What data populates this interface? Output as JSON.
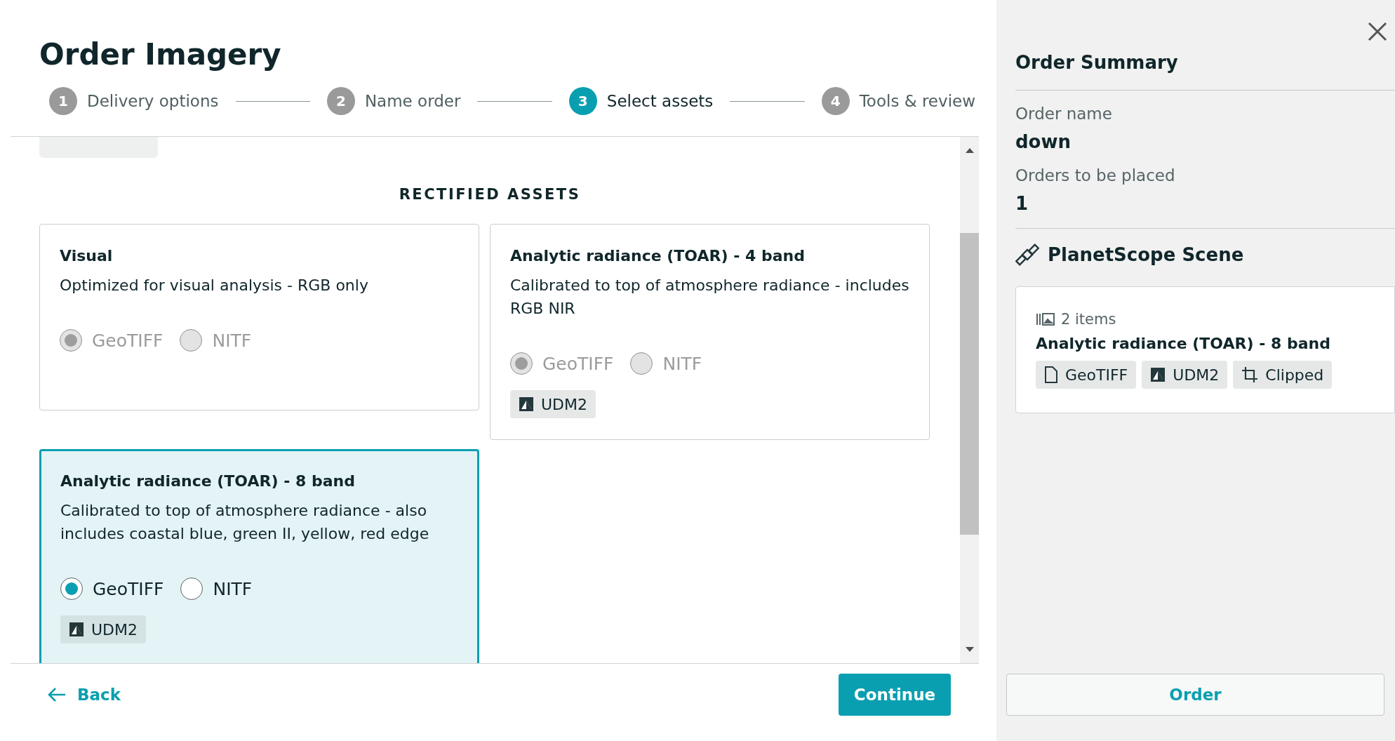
{
  "title": "Order Imagery",
  "steps": [
    {
      "number": "1",
      "label": "Delivery options",
      "selected": false
    },
    {
      "number": "2",
      "label": "Name order",
      "selected": false
    },
    {
      "number": "3",
      "label": "Select assets",
      "selected": true
    },
    {
      "number": "4",
      "label": "Tools & review",
      "selected": false
    }
  ],
  "section_heading": "RECTIFIED ASSETS",
  "assets": [
    {
      "title": "Visual",
      "description": "Optimized for visual analysis - RGB only",
      "disabled": true,
      "selected": false,
      "formats": [
        {
          "label": "GeoTIFF",
          "selected": true
        },
        {
          "label": "NITF",
          "selected": false
        }
      ]
    },
    {
      "title": "Analytic radiance (TOAR) - 4 band",
      "description": "Calibrated to top of atmosphere radiance - includes RGB NIR",
      "disabled": true,
      "selected": false,
      "formats": [
        {
          "label": "GeoTIFF",
          "selected": true
        },
        {
          "label": "NITF",
          "selected": false
        }
      ],
      "chips": [
        {
          "kind": "udm",
          "label": "UDM2"
        }
      ]
    },
    {
      "title": "Analytic radiance (TOAR) - 8 band",
      "description": "Calibrated to top of atmosphere radiance - also includes coastal blue, green II, yellow, red edge",
      "disabled": false,
      "selected": true,
      "formats": [
        {
          "label": "GeoTIFF",
          "selected": true
        },
        {
          "label": "NITF",
          "selected": false
        }
      ],
      "chips": [
        {
          "kind": "udm",
          "label": "UDM2"
        }
      ]
    }
  ],
  "footer": {
    "back": "Back",
    "continue": "Continue"
  },
  "summary": {
    "title": "Order Summary",
    "fields": [
      {
        "label": "Order name",
        "value": "down"
      },
      {
        "label": "Orders to be placed",
        "value": "1"
      }
    ],
    "product": "PlanetScope Scene",
    "item_count": "2 items",
    "asset_name": "Analytic radiance (TOAR) - 8 band",
    "chips": [
      {
        "kind": "file",
        "label": "GeoTIFF"
      },
      {
        "kind": "udm",
        "label": "UDM2"
      },
      {
        "kind": "clip",
        "label": "Clipped"
      }
    ],
    "order_button": "Order"
  }
}
